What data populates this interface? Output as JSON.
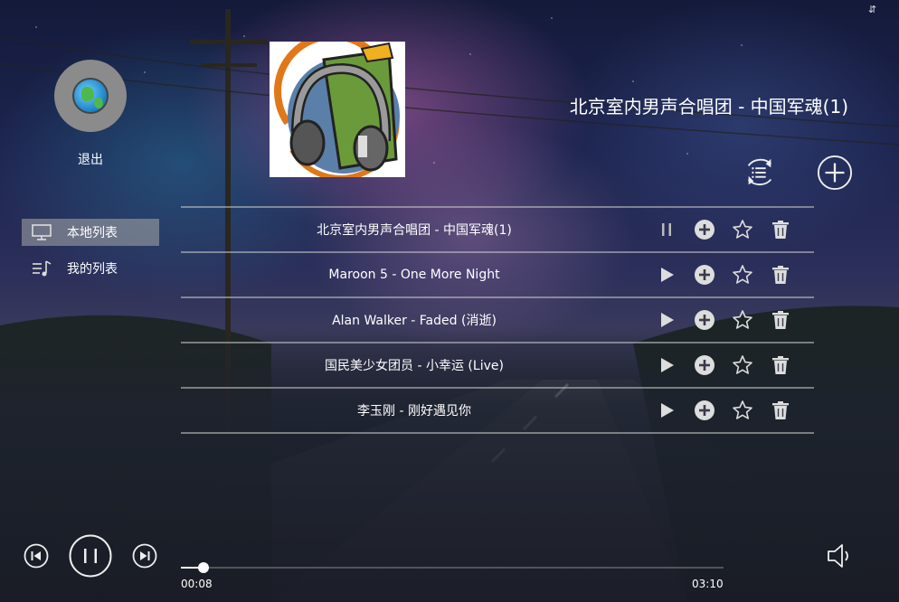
{
  "window": {
    "corner_glyph": "⇵"
  },
  "user": {
    "avatar_icon": "globe-icon",
    "logout_label": "退出"
  },
  "sidebar": {
    "items": [
      {
        "label": "本地列表",
        "icon": "monitor-icon",
        "active": true
      },
      {
        "label": "我的列表",
        "icon": "music-list-icon",
        "active": false
      }
    ]
  },
  "now_playing": {
    "title": "北京室内男声合唱团 - 中国军魂(1)",
    "album_art_icon": "headphones-icon"
  },
  "toolbar": {
    "play_mode_icon": "loop-list-icon",
    "add_icon": "add-circle-icon"
  },
  "songs": [
    {
      "name": "北京室内男声合唱团 - 中国军魂(1)",
      "state": "playing"
    },
    {
      "name": "Maroon 5 - One More Night",
      "state": "stopped"
    },
    {
      "name": "Alan Walker - Faded (消逝)",
      "state": "stopped"
    },
    {
      "name": "国民美少女团员 - 小幸运 (Live)",
      "state": "stopped"
    },
    {
      "name": "李玉刚 - 刚好遇见你",
      "state": "stopped"
    }
  ],
  "player": {
    "current_time": "00:08",
    "total_time": "03:10",
    "progress": 0.042,
    "colors": {
      "accent": "#ffffff"
    }
  }
}
